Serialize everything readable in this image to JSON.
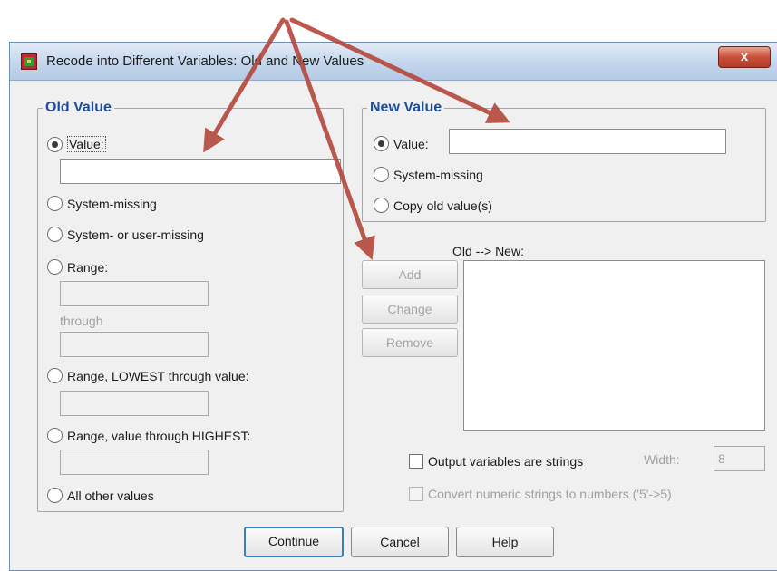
{
  "window": {
    "title": "Recode into Different Variables: Old and New Values",
    "close_glyph": "x"
  },
  "old_value": {
    "legend": "Old Value",
    "value_label": "Value:",
    "system_missing_label": "System-missing",
    "system_or_user_missing_label": "System- or user-missing",
    "range_label": "Range:",
    "through_label": "through",
    "range_lowest_label": "Range, LOWEST through value:",
    "range_highest_label": "Range, value through HIGHEST:",
    "all_other_label": "All other values",
    "selected": "Value:"
  },
  "new_value": {
    "legend": "New Value",
    "value_label": "Value:",
    "system_missing_label": "System-missing",
    "copy_old_label": "Copy old value(s)",
    "selected": "Value:"
  },
  "mapping": {
    "list_label": "Old --> New:",
    "add_label": "Add",
    "change_label": "Change",
    "remove_label": "Remove",
    "items": []
  },
  "options": {
    "output_strings_label": "Output variables are strings",
    "output_strings_checked": false,
    "width_label": "Width:",
    "width_value": "8",
    "convert_numeric_label": "Convert numeric strings to numbers ('5'->5)",
    "convert_numeric_checked": false
  },
  "footer": {
    "continue_label": "Continue",
    "cancel_label": "Cancel",
    "help_label": "Help"
  },
  "annotation": {
    "arrow_color": "#b5473c"
  },
  "colors": {
    "legend": "#1e4c9a",
    "dialog_bg": "#f0f0f0",
    "title_bar": "#c4d6ec"
  }
}
